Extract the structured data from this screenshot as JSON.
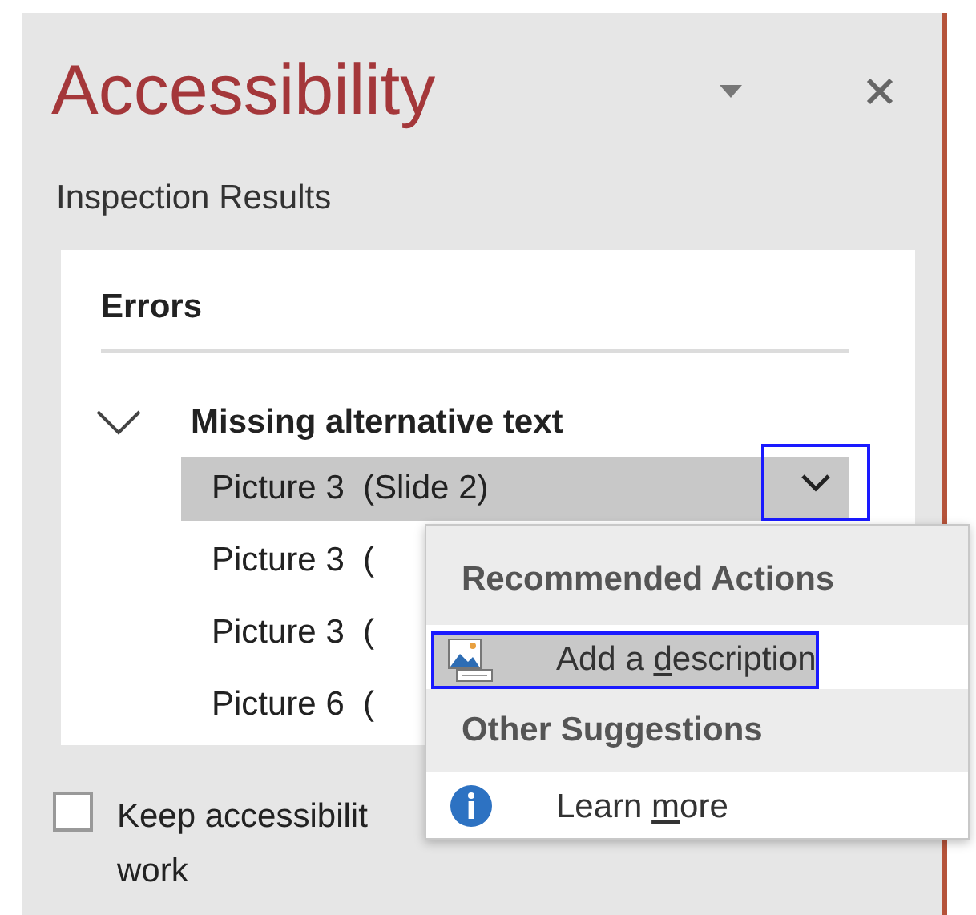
{
  "pane": {
    "title": "Accessibility",
    "subtitle": "Inspection Results"
  },
  "results": {
    "heading": "Errors",
    "groups": [
      {
        "label": "Missing alternative text",
        "expanded": true,
        "items": [
          {
            "label": "Picture 3  (Slide 2)",
            "selected": true
          },
          {
            "label": "Picture 3  (",
            "selected": false
          },
          {
            "label": "Picture 3  (",
            "selected": false
          },
          {
            "label": "Picture 6  (",
            "selected": false
          }
        ]
      }
    ]
  },
  "keep_running": {
    "checked": false,
    "lines": [
      "Keep accessibilit",
      "work"
    ]
  },
  "menu": {
    "sections": [
      {
        "header": "Recommended Actions",
        "items": [
          {
            "kind": "picture",
            "before": "Add a ",
            "key": "d",
            "after": "escription",
            "selected": true
          }
        ]
      },
      {
        "header": "Other Suggestions",
        "items": [
          {
            "kind": "info",
            "before": "Learn ",
            "key": "m",
            "after": "ore",
            "selected": false
          }
        ]
      }
    ]
  }
}
